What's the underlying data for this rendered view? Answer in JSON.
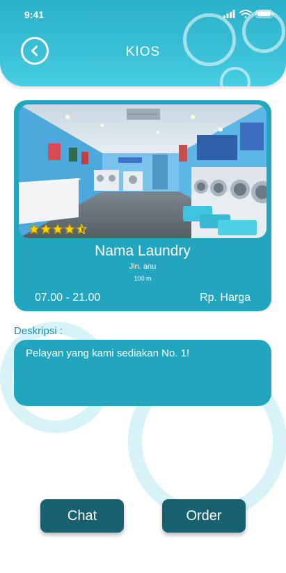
{
  "status_bar": {
    "time": "9:41"
  },
  "header": {
    "title": "KIOS",
    "back_icon": "chevron-left-icon"
  },
  "laundry": {
    "name": "Nama Laundry",
    "address": "Jln. anu",
    "distance": "100 m",
    "hours": "07.00 - 21.00",
    "price": "Rp. Harga",
    "rating": 4.5,
    "rating_max": 5
  },
  "description": {
    "label": "Deskripsi :",
    "text": "Pelayan yang kami sediakan No. 1!"
  },
  "actions": {
    "chat_label": "Chat",
    "order_label": "Order"
  },
  "colors": {
    "accent": "#22a6bf",
    "header": "#3ec3d9",
    "button": "#186170",
    "star": "#ffd400"
  }
}
